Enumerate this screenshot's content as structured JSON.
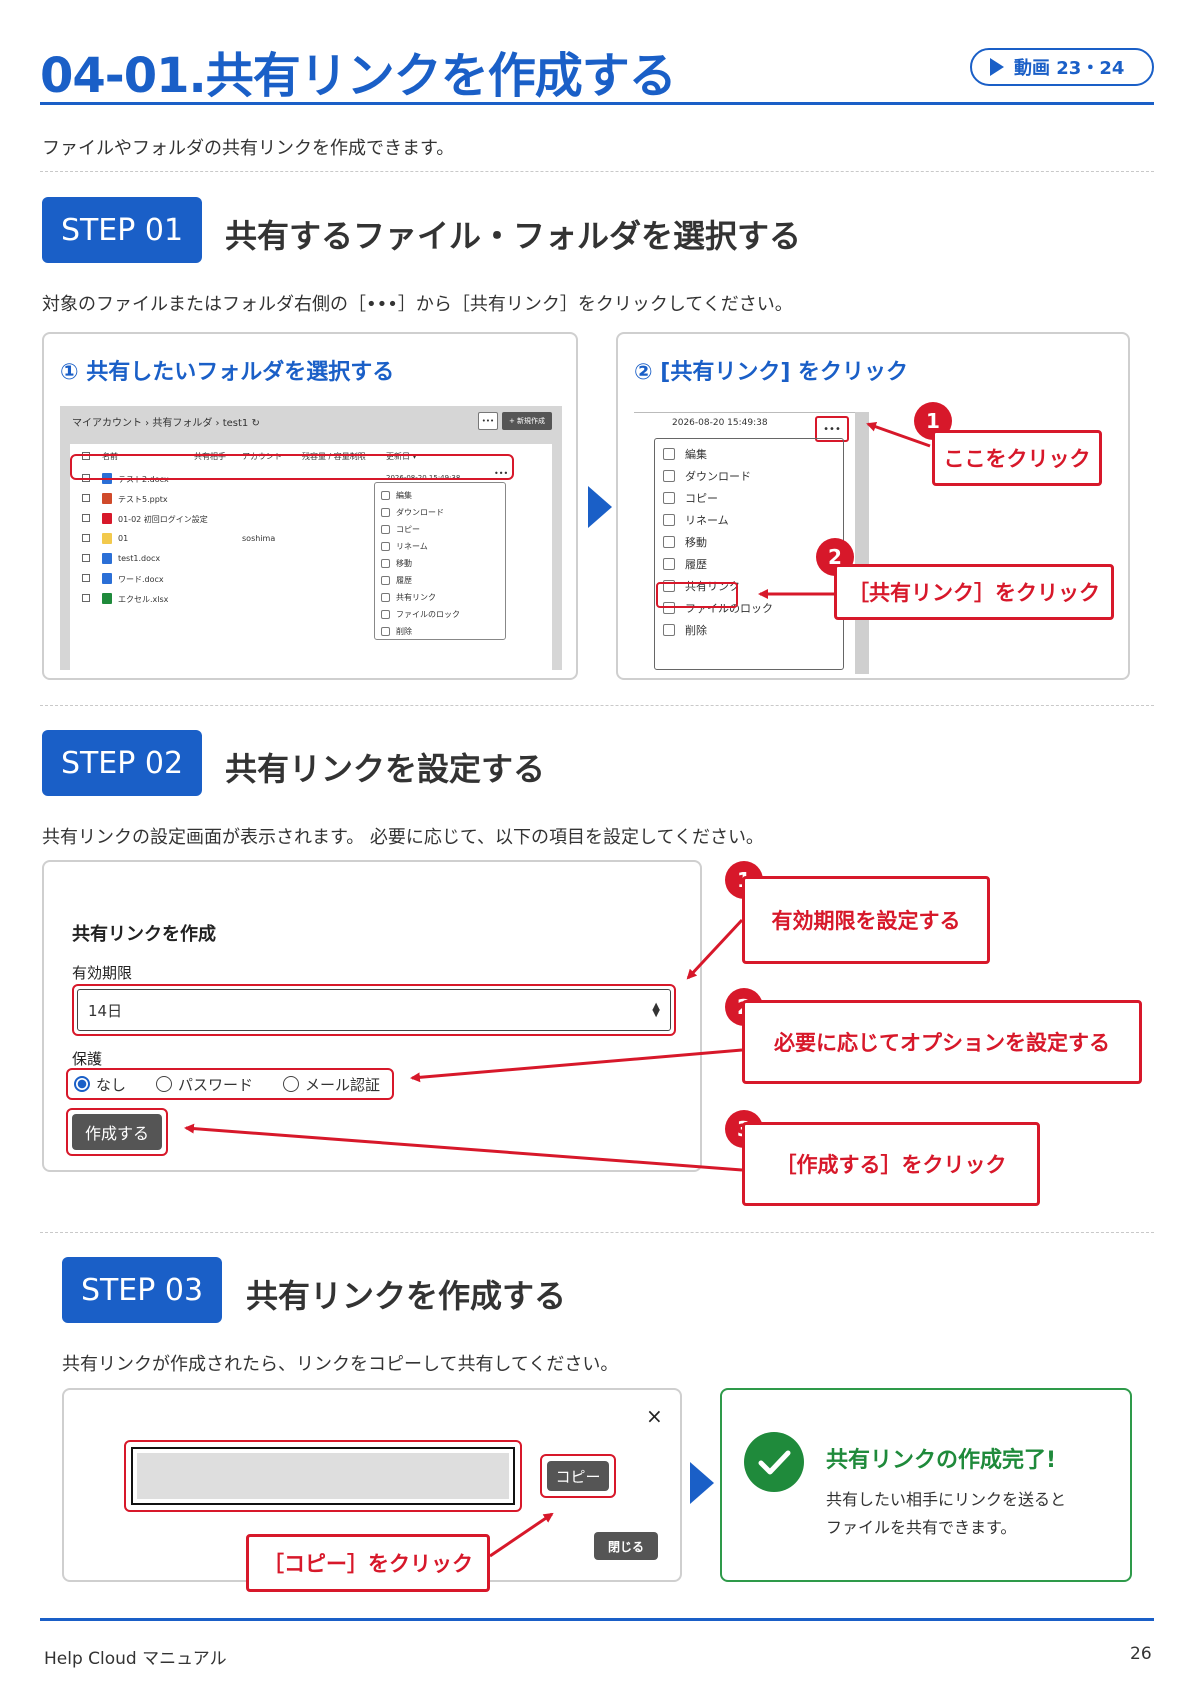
{
  "header": {
    "title": "04-01.共有リンクを作成する",
    "video_label": "動画 23・24",
    "intro": "ファイルやフォルダの共有リンクを作成できます。"
  },
  "step1": {
    "badge": "STEP 01",
    "title": "共有するファイル・フォルダを選択する",
    "lead": "対象のファイルまたはフォルダ右側の［•••］から［共有リンク］をクリックしてください。",
    "panel1_title": "① 共有したいフォルダを選択する",
    "panel2_title": "② [共有リンク] をクリック",
    "mini": {
      "breadcrumb": "マイアカウント › 共有フォルダ › test1 ↻",
      "new_button": "+ 新規作成",
      "more": "•••",
      "columns": [
        "名前",
        "共有相手",
        "アカウント",
        "残容量 / 容量制限",
        "更新日 ▾"
      ],
      "rows": [
        {
          "name": "テスト2.docx",
          "account": "",
          "date": "2026-08-20 15:49:38",
          "color": "#2b6fd6"
        },
        {
          "name": "テスト5.pptx",
          "account": "",
          "date": "",
          "color": "#d04a2b"
        },
        {
          "name": "01-02 初回ログイン設定",
          "account": "",
          "date": "",
          "color": "#d7182a"
        },
        {
          "name": "01",
          "account": "soshima",
          "date": "",
          "color": "#f2c94c"
        },
        {
          "name": "test1.docx",
          "account": "",
          "date": "",
          "color": "#2b6fd6"
        },
        {
          "name": "ワード.docx",
          "account": "",
          "date": "",
          "color": "#2b6fd6"
        },
        {
          "name": "エクセル.xlsx",
          "account": "",
          "date": "",
          "color": "#1f8a3b"
        }
      ],
      "menu": [
        "編集",
        "ダウンロード",
        "コピー",
        "リネーム",
        "移動",
        "履歴",
        "共有リンク",
        "ファイルのロック",
        "削除"
      ]
    },
    "panel2": {
      "timestamp": "2026-08-20 15:49:38",
      "more": "•••",
      "menu": [
        "編集",
        "ダウンロード",
        "コピー",
        "リネーム",
        "移動",
        "履歴",
        "共有リンク",
        "ファイルのロック",
        "削除"
      ],
      "callout1": "ここをクリック",
      "callout2": "［共有リンク］をクリック",
      "num1": "1",
      "num2": "2"
    }
  },
  "step2": {
    "badge": "STEP 02",
    "title": "共有リンクを設定する",
    "lead": "共有リンクの設定画面が表示されます。 必要に応じて、以下の項目を設定してください。",
    "dialog_title": "共有リンクを作成",
    "expiry_label": "有効期限",
    "expiry_value": "14日",
    "protect_label": "保護",
    "options": [
      "なし",
      "パスワード",
      "メール認証"
    ],
    "create_button": "作成する",
    "callout1": "有効期限を設定する",
    "callout2": "必要に応じてオプションを設定する",
    "callout3": "［作成する］をクリック",
    "num1": "1",
    "num2": "2",
    "num3": "3"
  },
  "step3": {
    "badge": "STEP 03",
    "title": "共有リンクを作成する",
    "lead": "共有リンクが作成されたら、リンクをコピーして共有してください。",
    "close_x": "×",
    "copy_button": "コピー",
    "close_button": "閉じる",
    "callout": "［コピー］をクリック",
    "done_title": "共有リンクの作成完了!",
    "done_line1": "共有したい相手にリンクを送ると",
    "done_line2": "ファイルを共有できます。"
  },
  "footer": {
    "product": "Help Cloud マニュアル",
    "page": "26"
  }
}
